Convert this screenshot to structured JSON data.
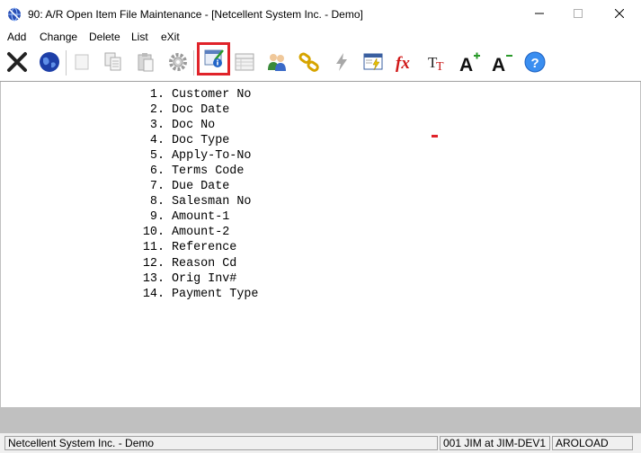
{
  "window": {
    "title": "90: A/R Open Item File Maintenance - [Netcellent System Inc. - Demo]",
    "app_icon": "globe-icon",
    "controls": [
      "minimize-icon",
      "maximize-icon",
      "close-icon"
    ]
  },
  "menu": {
    "items": [
      {
        "label": "Add"
      },
      {
        "label": "Change"
      },
      {
        "label": "Delete"
      },
      {
        "label": "List"
      },
      {
        "label": "eXit"
      }
    ]
  },
  "toolbar": {
    "buttons": [
      {
        "icon": "exit-x-icon",
        "enabled": true
      },
      {
        "icon": "internet-globe-icon",
        "enabled": true
      },
      {
        "icon": "blank-icon",
        "enabled": false
      },
      {
        "icon": "copy-icon",
        "enabled": false
      },
      {
        "icon": "paste-icon",
        "enabled": false
      },
      {
        "icon": "settings-gear-icon",
        "enabled": false
      },
      {
        "icon": "notes-info-icon",
        "enabled": true,
        "selected": true
      },
      {
        "icon": "table-view-icon",
        "enabled": false
      },
      {
        "icon": "users-icon",
        "enabled": true
      },
      {
        "icon": "chain-link-icon",
        "enabled": true
      },
      {
        "icon": "lightning-icon",
        "enabled": false
      },
      {
        "icon": "screen-lightning-icon",
        "enabled": true
      },
      {
        "icon": "function-fx-icon",
        "enabled": true
      },
      {
        "icon": "font-tt-icon",
        "enabled": true
      },
      {
        "icon": "font-increase-icon",
        "enabled": true
      },
      {
        "icon": "font-decrease-icon",
        "enabled": true
      },
      {
        "icon": "help-question-icon",
        "enabled": true
      }
    ],
    "colors": {
      "selected_border": "#e0232a"
    }
  },
  "fields": [
    {
      "num": "1.",
      "label": "Customer No"
    },
    {
      "num": "2.",
      "label": "Doc Date"
    },
    {
      "num": "3.",
      "label": "Doc No"
    },
    {
      "num": "4.",
      "label": "Doc Type"
    },
    {
      "num": "5.",
      "label": "Apply-To-No"
    },
    {
      "num": "6.",
      "label": "Terms Code"
    },
    {
      "num": "7.",
      "label": "Due Date"
    },
    {
      "num": "8.",
      "label": "Salesman No"
    },
    {
      "num": "9.",
      "label": "Amount-1"
    },
    {
      "num": "10.",
      "label": "Amount-2"
    },
    {
      "num": "11.",
      "label": "Reference"
    },
    {
      "num": "12.",
      "label": "Reason Cd"
    },
    {
      "num": "13.",
      "label": "Orig Inv#"
    },
    {
      "num": "14.",
      "label": "Payment Type"
    }
  ],
  "status": {
    "company": "Netcellent System Inc. - Demo",
    "user": "001 JIM at JIM-DEV1",
    "program": "AROLOAD"
  }
}
